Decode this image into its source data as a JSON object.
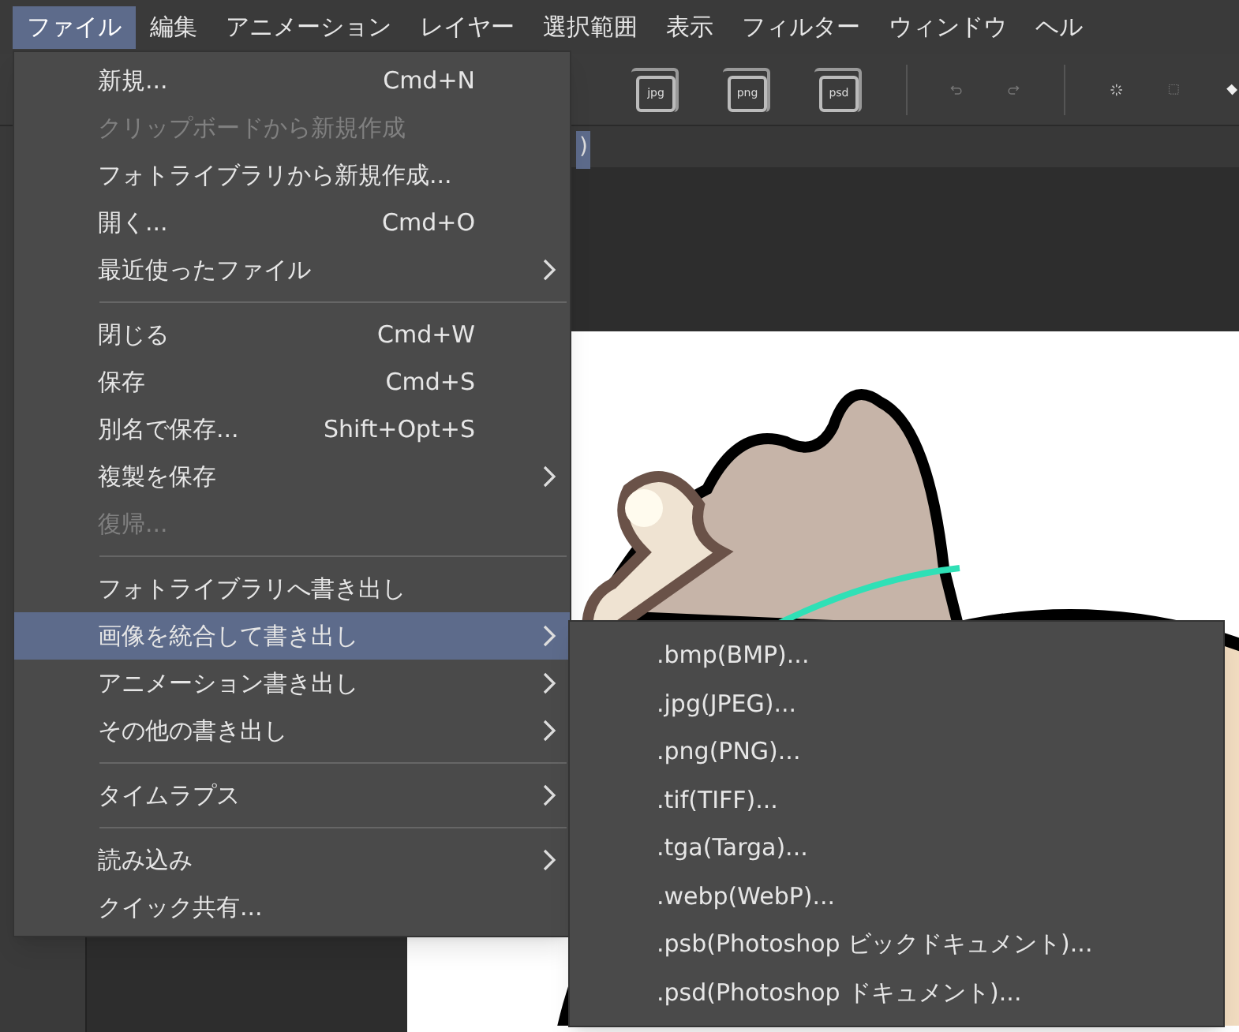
{
  "menubar": [
    {
      "label": "ファイル",
      "selected": true
    },
    {
      "label": "編集",
      "selected": false
    },
    {
      "label": "アニメーション",
      "selected": false
    },
    {
      "label": "レイヤー",
      "selected": false
    },
    {
      "label": "選択範囲",
      "selected": false
    },
    {
      "label": "表示",
      "selected": false
    },
    {
      "label": "フィルター",
      "selected": false
    },
    {
      "label": "ウィンドウ",
      "selected": false
    },
    {
      "label": "ヘル",
      "selected": false
    }
  ],
  "toolbar": {
    "file_icons": [
      "jpg",
      "png",
      "psd"
    ]
  },
  "document_tab": {
    "label": ")"
  },
  "file_menu": [
    {
      "kind": "item",
      "label": "新規...",
      "shortcut": "Cmd+N",
      "disabled": false,
      "submenu": false,
      "selected": false
    },
    {
      "kind": "item",
      "label": "クリップボードから新規作成",
      "disabled": true,
      "submenu": false,
      "selected": false
    },
    {
      "kind": "item",
      "label": "フォトライブラリから新規作成...",
      "disabled": false,
      "submenu": false,
      "selected": false
    },
    {
      "kind": "item",
      "label": "開く...",
      "shortcut": "Cmd+O",
      "disabled": false,
      "submenu": false,
      "selected": false
    },
    {
      "kind": "item",
      "label": "最近使ったファイル",
      "disabled": false,
      "submenu": true,
      "selected": false
    },
    {
      "kind": "separator"
    },
    {
      "kind": "item",
      "label": "閉じる",
      "shortcut": "Cmd+W",
      "disabled": false,
      "submenu": false,
      "selected": false
    },
    {
      "kind": "item",
      "label": "保存",
      "shortcut": "Cmd+S",
      "disabled": false,
      "submenu": false,
      "selected": false
    },
    {
      "kind": "item",
      "label": "別名で保存...",
      "shortcut": "Shift+Opt+S",
      "disabled": false,
      "submenu": false,
      "selected": false
    },
    {
      "kind": "item",
      "label": "複製を保存",
      "disabled": false,
      "submenu": true,
      "selected": false
    },
    {
      "kind": "item",
      "label": "復帰...",
      "disabled": true,
      "submenu": false,
      "selected": false
    },
    {
      "kind": "separator"
    },
    {
      "kind": "item",
      "label": "フォトライブラリへ書き出し",
      "disabled": false,
      "submenu": false,
      "selected": false
    },
    {
      "kind": "item",
      "label": "画像を統合して書き出し",
      "disabled": false,
      "submenu": true,
      "selected": true
    },
    {
      "kind": "item",
      "label": "アニメーション書き出し",
      "disabled": false,
      "submenu": true,
      "selected": false
    },
    {
      "kind": "item",
      "label": "その他の書き出し",
      "disabled": false,
      "submenu": true,
      "selected": false
    },
    {
      "kind": "separator"
    },
    {
      "kind": "item",
      "label": "タイムラプス",
      "disabled": false,
      "submenu": true,
      "selected": false
    },
    {
      "kind": "separator"
    },
    {
      "kind": "item",
      "label": "読み込み",
      "disabled": false,
      "submenu": true,
      "selected": false
    },
    {
      "kind": "item",
      "label": "クイック共有...",
      "disabled": false,
      "submenu": false,
      "selected": false
    }
  ],
  "export_submenu": [
    ".bmp(BMP)...",
    ".jpg(JPEG)...",
    ".png(PNG)...",
    ".tif(TIFF)...",
    ".tga(Targa)...",
    ".webp(WebP)...",
    ".psb(Photoshop ビックドキュメント)...",
    ".psd(Photoshop ドキュメント)..."
  ]
}
